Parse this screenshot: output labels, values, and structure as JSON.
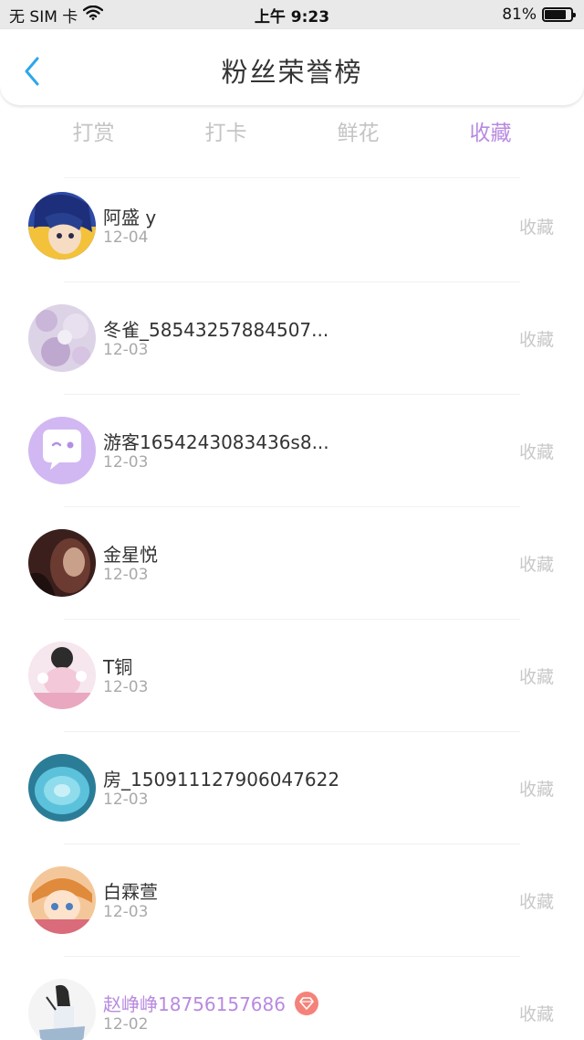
{
  "status_bar": {
    "carrier": "无 SIM 卡",
    "time": "上午 9:23",
    "battery": "81%",
    "battery_level": 0.81,
    "wifi_icon": "wifi-icon",
    "battery_icon": "battery-icon"
  },
  "header": {
    "title": "粉丝荣誉榜",
    "back_icon": "chevron-left-icon",
    "accent_color": "#2ea6ea"
  },
  "tabs": [
    {
      "label": "打赏",
      "active": false
    },
    {
      "label": "打卡",
      "active": false
    },
    {
      "label": "鲜花",
      "active": false
    },
    {
      "label": "收藏",
      "active": true
    }
  ],
  "active_color": "#b88ae0",
  "fans": [
    {
      "name": "阿盛 y",
      "date": "12-04",
      "action": "收藏",
      "vip": false
    },
    {
      "name": "冬雀_58543257884507...",
      "date": "12-03",
      "action": "收藏",
      "vip": false
    },
    {
      "name": "游客1654243083436s8...",
      "date": "12-03",
      "action": "收藏",
      "vip": false
    },
    {
      "name": "金星悦",
      "date": "12-03",
      "action": "收藏",
      "vip": false
    },
    {
      "name": "T铜",
      "date": "12-03",
      "action": "收藏",
      "vip": false
    },
    {
      "name": "房_150911127906047622",
      "date": "12-03",
      "action": "收藏",
      "vip": false
    },
    {
      "name": "白霖萱",
      "date": "12-03",
      "action": "收藏",
      "vip": false
    },
    {
      "name": "赵峥峥18756157686",
      "date": "12-02",
      "action": "收藏",
      "vip": true
    }
  ]
}
